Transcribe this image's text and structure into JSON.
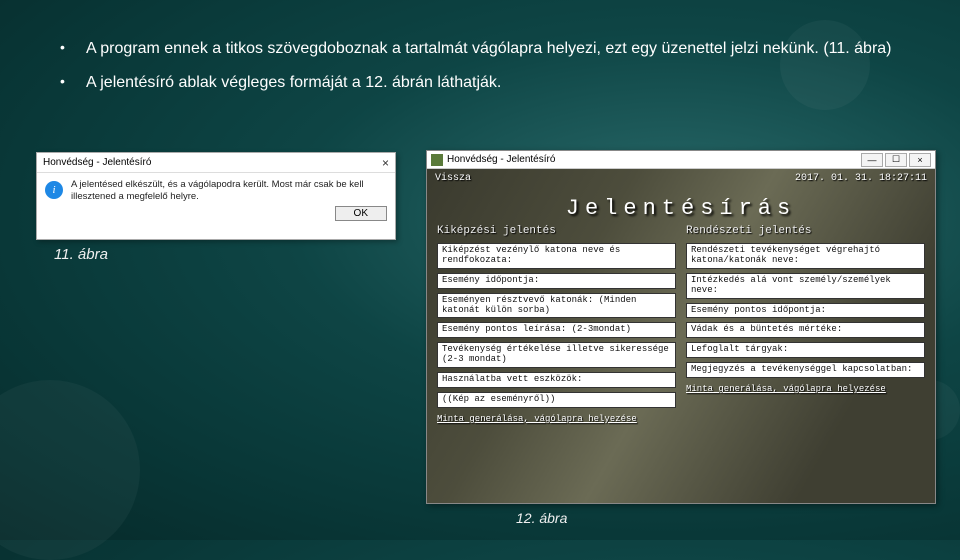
{
  "bullets": [
    "A program ennek a titkos szövegdoboznak a tartalmát vágólapra helyezi, ezt egy üzenettel jelzi nekünk. (11. ábra)",
    "A jelentésíró ablak végleges formáját a 12. ábrán láthatják."
  ],
  "captions": {
    "c11": "11. ábra",
    "c12": "12. ábra"
  },
  "dlg11": {
    "title": "Honvédség - Jelentésíró",
    "msg": "A jelentésed elkészült, és a vágólapodra került. Most már csak be kell illesztened a megfelelő helyre.",
    "ok": "OK"
  },
  "win12": {
    "title": "Honvédség - Jelentésíró",
    "back": "Vissza",
    "datetime": "2017. 01. 31. 18:27:11",
    "heading": "Jelentésírás",
    "left": {
      "subhead": "Kiképzési jelentés",
      "fields": [
        "Kiképzést vezénylő katona neve és rendfokozata:",
        "Esemény időpontja:",
        "Eseményen résztvevő katonák: (Minden katonát külön sorba)",
        "Esemény pontos leírása: (2-3mondat)",
        "Tevékenység értékelése illetve sikeressége (2-3 mondat)",
        "Használatba vett eszközök:",
        "((Kép az eseményről))"
      ],
      "bottom": "Minta generálása, vágólapra helyezése"
    },
    "right": {
      "subhead": "Rendészeti jelentés",
      "fields": [
        "Rendészeti tevékenységet végrehajtó katona/katonák neve:",
        "Intézkedés alá vont személy/személyek neve:",
        "Esemény pontos időpontja:",
        "Vádak és a büntetés mértéke:",
        "Lefoglalt tárgyak:",
        "Megjegyzés a tevékenységgel kapcsolatban:"
      ],
      "bottom": "Minta generálása, vágólapra helyezése"
    }
  }
}
